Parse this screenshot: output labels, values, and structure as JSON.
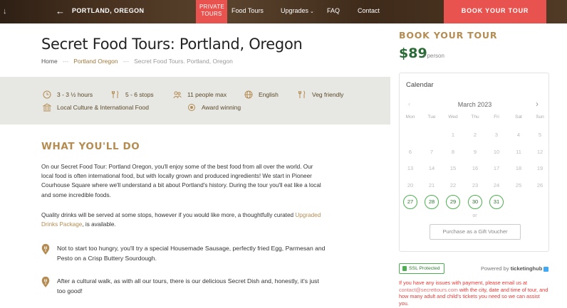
{
  "nav": {
    "scroll_icon": "arrow-down-icon",
    "back_icon": "arrow-left-icon",
    "city": "PORTLAND, OREGON",
    "private_tours": "PRIVATE TOURS",
    "links": [
      "Food Tours",
      "Upgrades",
      "FAQ",
      "Contact"
    ],
    "book": "BOOK YOUR TOUR"
  },
  "header": {
    "title": "Secret Food Tours: Portland, Oregon",
    "breadcrumbs": [
      "Home",
      "Portland Oregon",
      "Secret Food Tours. Portland, Oregon"
    ],
    "breadcrumb_sep": "---"
  },
  "info": {
    "duration": "3 - 3 ½ hours",
    "stops": "5 - 6 stops",
    "group": "11 people max",
    "language": "English",
    "veg": "Veg friendly",
    "culture": "Local Culture & International Food",
    "award": "Award winning"
  },
  "section": {
    "title": "WHAT YOU'LL DO",
    "p1": "On our Secret Food Tour: Portland Oregon, you'll enjoy some of the best food from all over the world. Our local food is often international food, but with locally grown and produced ingredients! We start in Pioneer Courhouse Square where we'll understand a bit about Portland's history. During the tour you'll eat like a local and some incredible foods.",
    "p2_before": "Quality drinks will be served at some stops, however if you would like more, a thoughtfully curated ",
    "p2_link": "Upgraded Drinks Package",
    "p2_after": ", is available.",
    "bullet1": "Not to start too hungry, you'll try a special Housemade Sausage, perfectly fried Egg, Parmesan and Pesto on a Crisp Buttery Sourdough.",
    "bullet2": "After a cultural walk, as with all our tours, there is our delicious Secret Dish and, honestly, it's just too good!"
  },
  "booking": {
    "title": "BOOK YOUR TOUR",
    "price": "$89",
    "per": "/ person",
    "calendar_label": "Calendar",
    "month": "March 2023",
    "weekdays": [
      "Mon",
      "Tue",
      "Wed",
      "Thu",
      "Fri",
      "Sat",
      "Sun"
    ],
    "or": "or",
    "gift": "Purchase as a Gift Voucher",
    "ssl": "SSL Protected",
    "powered_by": "Powered by",
    "ticketinghub": "ticketinghub",
    "issues_1": "If you have any issues with payment, please email us at ",
    "issues_email": "contact@secrettours.com",
    "issues_2": " with the city, date and time of tour, and how many adult and child's tickets you need so we can assist you."
  },
  "colors": {
    "accent_red": "#e8534f",
    "gold": "#b48c52",
    "price_green": "#2a6a36",
    "available_green": "#4caf50"
  }
}
